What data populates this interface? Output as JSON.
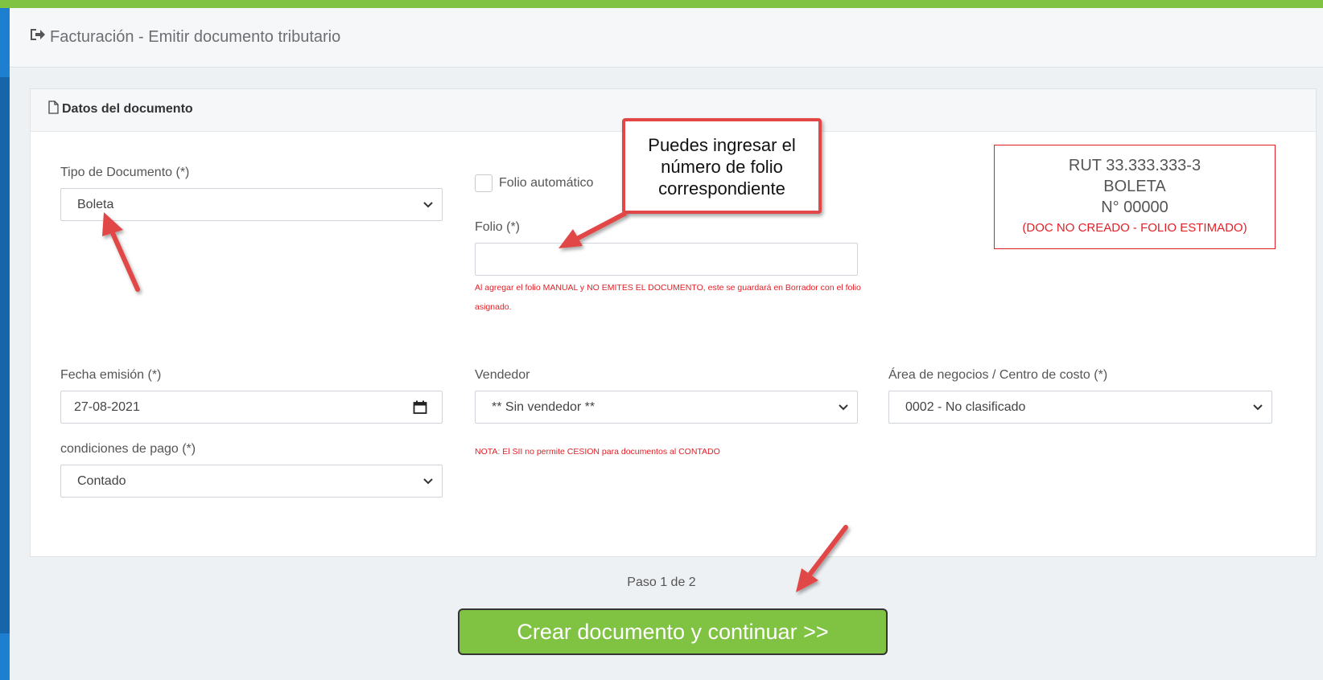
{
  "header": {
    "title": "Facturación - Emitir documento tributario"
  },
  "card": {
    "title": "Datos del documento"
  },
  "form": {
    "tipo_documento": {
      "label": "Tipo de Documento (*)",
      "value": "Boleta"
    },
    "folio_automatico": {
      "label": "Folio automático",
      "checked": false
    },
    "folio": {
      "label": "Folio (*)",
      "value": "",
      "note": "Al agregar el folio MANUAL y NO EMITES EL DOCUMENTO, este se guardará en Borrador con el folio asignado."
    },
    "fecha_emision": {
      "label": "Fecha emisión (*)",
      "value": "27-08-2021"
    },
    "vendedor": {
      "label": "Vendedor",
      "value": "** Sin vendedor **",
      "note": "NOTA: El SII no permite CESION para documentos al CONTADO"
    },
    "area_negocios": {
      "label": "Área de negocios / Centro de costo (*)",
      "value": "0002 - No clasificado"
    },
    "condiciones_pago": {
      "label": "condiciones de pago (*)",
      "value": "Contado"
    }
  },
  "rut_box": {
    "rut": "RUT 33.333.333-3",
    "doc_type": "BOLETA",
    "number": "N° 00000",
    "status": "(DOC NO CREADO - FOLIO ESTIMADO)"
  },
  "callout": {
    "text": "Puedes ingresar el número de folio correspondiente"
  },
  "footer": {
    "step": "Paso 1 de 2",
    "submit_label": "Crear documento y continuar >>"
  },
  "colors": {
    "accent_green": "#80c342",
    "alert_red": "#e21f26",
    "annotation_red": "#e24646",
    "sidebar_blue": "#1565a8"
  },
  "icons": {
    "page_title": "sign-out-icon",
    "card_title": "document-icon",
    "select": "chevron-down-icon",
    "date": "calendar-icon"
  }
}
